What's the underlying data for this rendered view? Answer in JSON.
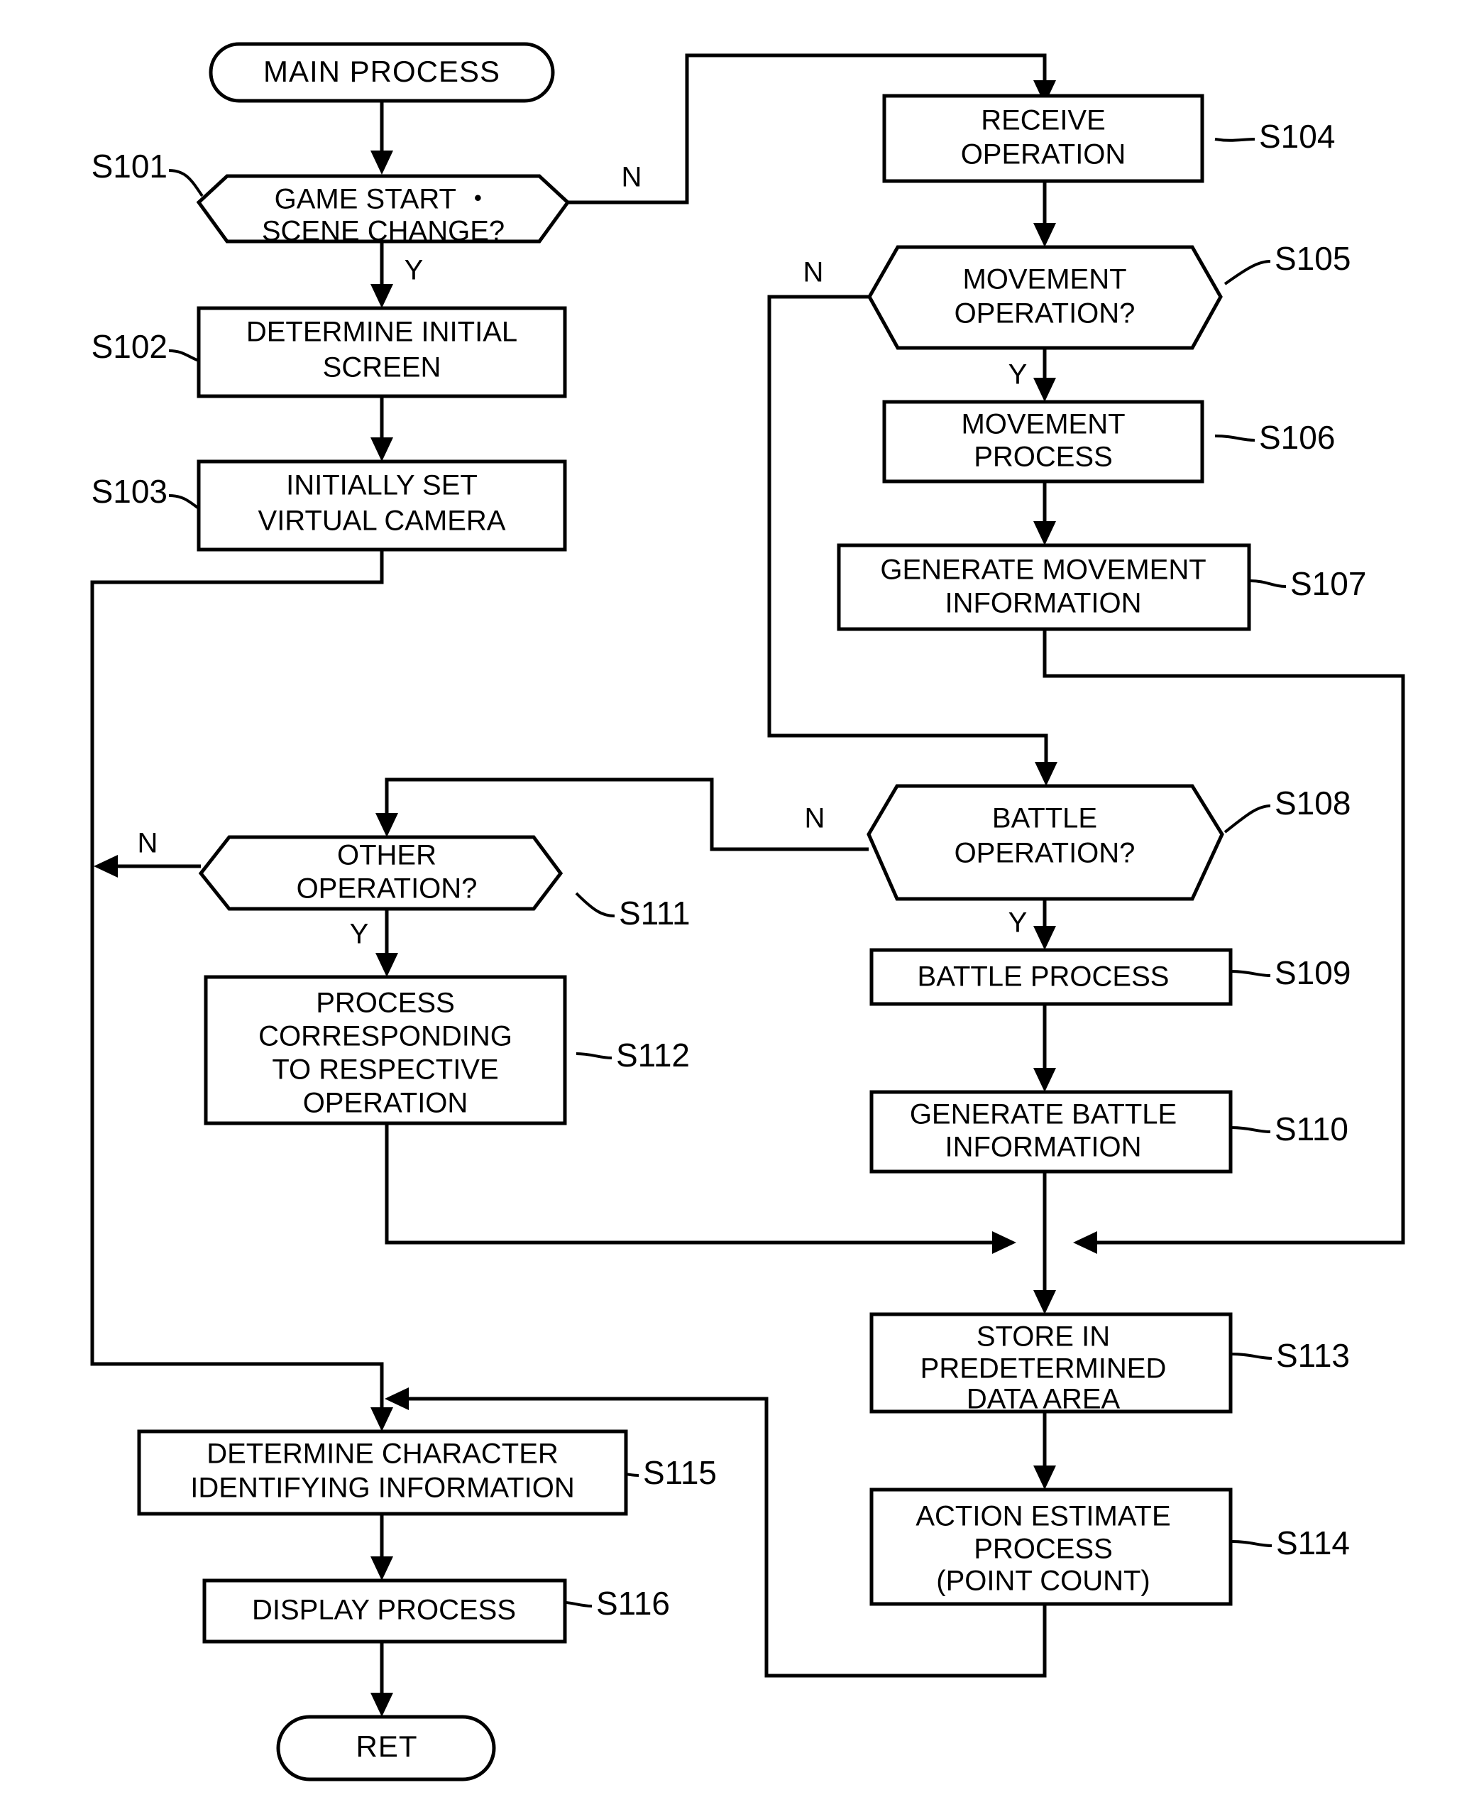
{
  "diagram": {
    "type": "flowchart",
    "title": "MAIN PROCESS flowchart",
    "nodes": {
      "start": {
        "id": "",
        "label": "MAIN PROCESS",
        "shape": "terminator"
      },
      "s101": {
        "id": "S101",
        "line1": "GAME START ・",
        "line2": "SCENE CHANGE?",
        "shape": "decision"
      },
      "s102": {
        "id": "S102",
        "line1": "DETERMINE INITIAL",
        "line2": "SCREEN",
        "shape": "process"
      },
      "s103": {
        "id": "S103",
        "line1": "INITIALLY SET",
        "line2": "VIRTUAL CAMERA",
        "shape": "process"
      },
      "s104": {
        "id": "S104",
        "line1": "RECEIVE",
        "line2": "OPERATION",
        "shape": "process"
      },
      "s105": {
        "id": "S105",
        "line1": "MOVEMENT",
        "line2": "OPERATION?",
        "shape": "decision"
      },
      "s106": {
        "id": "S106",
        "line1": "MOVEMENT",
        "line2": "PROCESS",
        "shape": "process"
      },
      "s107": {
        "id": "S107",
        "line1": "GENERATE MOVEMENT",
        "line2": "INFORMATION",
        "shape": "process"
      },
      "s108": {
        "id": "S108",
        "line1": "BATTLE",
        "line2": "OPERATION?",
        "shape": "decision"
      },
      "s109": {
        "id": "S109",
        "line1": "BATTLE PROCESS",
        "shape": "process"
      },
      "s110": {
        "id": "S110",
        "line1": "GENERATE BATTLE",
        "line2": "INFORMATION",
        "shape": "process"
      },
      "s111": {
        "id": "S111",
        "line1": "OTHER",
        "line2": "OPERATION?",
        "shape": "decision"
      },
      "s112": {
        "id": "S112",
        "line1": "PROCESS",
        "line2": "CORRESPONDING",
        "line3": "TO RESPECTIVE",
        "line4": "OPERATION",
        "shape": "process"
      },
      "s113": {
        "id": "S113",
        "line1": "STORE IN",
        "line2": "PREDETERMINED",
        "line3": "DATA AREA",
        "shape": "process"
      },
      "s114": {
        "id": "S114",
        "line1": "ACTION ESTIMATE",
        "line2": "PROCESS",
        "line3": "(POINT COUNT)",
        "shape": "process"
      },
      "s115": {
        "id": "S115",
        "line1": "DETERMINE CHARACTER",
        "line2": "IDENTIFYING INFORMATION",
        "shape": "process"
      },
      "s116": {
        "id": "S116",
        "line1": "DISPLAY PROCESS",
        "shape": "process"
      },
      "end": {
        "id": "",
        "label": "RET",
        "shape": "terminator"
      }
    },
    "branch_labels": {
      "s101_no": "N",
      "s101_yes": "Y",
      "s105_no": "N",
      "s105_yes": "Y",
      "s108_no": "N",
      "s108_yes": "Y",
      "s111_no": "N",
      "s111_yes": "Y"
    },
    "colors": {
      "stroke": "#000000",
      "fill": "#ffffff",
      "background": "#ffffff"
    }
  }
}
